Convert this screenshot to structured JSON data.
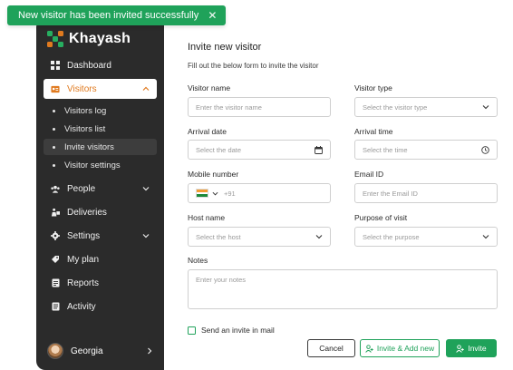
{
  "toast": {
    "message": "New visitor has been invited successfully",
    "close_icon": "close-icon",
    "color": "#1fa25a"
  },
  "brand": {
    "name": "Khayash"
  },
  "sidebar": {
    "items": [
      {
        "label": "Dashboard",
        "icon": "dashboard-icon"
      },
      {
        "label": "Visitors",
        "icon": "visitor-card-icon",
        "active": true
      },
      {
        "label": "People",
        "icon": "people-icon"
      },
      {
        "label": "Deliveries",
        "icon": "deliveries-icon"
      },
      {
        "label": "Settings",
        "icon": "gear-icon"
      },
      {
        "label": "My plan",
        "icon": "tag-icon"
      },
      {
        "label": "Reports",
        "icon": "reports-icon"
      },
      {
        "label": "Activity",
        "icon": "activity-icon"
      }
    ],
    "visitors_sub": [
      {
        "label": "Visitors log"
      },
      {
        "label": "Visitors list"
      },
      {
        "label": "Invite visitors",
        "active": true
      },
      {
        "label": "Visitor settings"
      }
    ],
    "user": {
      "name": "Georgia"
    }
  },
  "form": {
    "title": "Invite new visitor",
    "subtitle": "Fill out the below form to invite the visitor",
    "visitor_name": {
      "label": "Visitor name",
      "placeholder": "Enter the visitor name"
    },
    "visitor_type": {
      "label": "Visitor type",
      "placeholder": "Select the visitor type"
    },
    "arrival_date": {
      "label": "Arrival date",
      "placeholder": "Select the date"
    },
    "arrival_time": {
      "label": "Arrival time",
      "placeholder": "Select the time"
    },
    "mobile": {
      "label": "Mobile number",
      "prefix": "+91"
    },
    "email": {
      "label": "Email ID",
      "placeholder": "Enter the Email ID"
    },
    "host": {
      "label": "Host name",
      "placeholder": "Select the host"
    },
    "purpose": {
      "label": "Purpose of visit",
      "placeholder": "Select the purpose"
    },
    "notes": {
      "label": "Notes",
      "placeholder": "Enter your notes"
    },
    "send_invite": {
      "label": "Send an invite in mail"
    }
  },
  "buttons": {
    "cancel": "Cancel",
    "invite_add_new": "Invite & Add new",
    "invite": "Invite"
  },
  "colors": {
    "accent": "#1fa25a",
    "active_nav": "#e07a1f",
    "sidebar_bg": "#2b2b2b"
  }
}
